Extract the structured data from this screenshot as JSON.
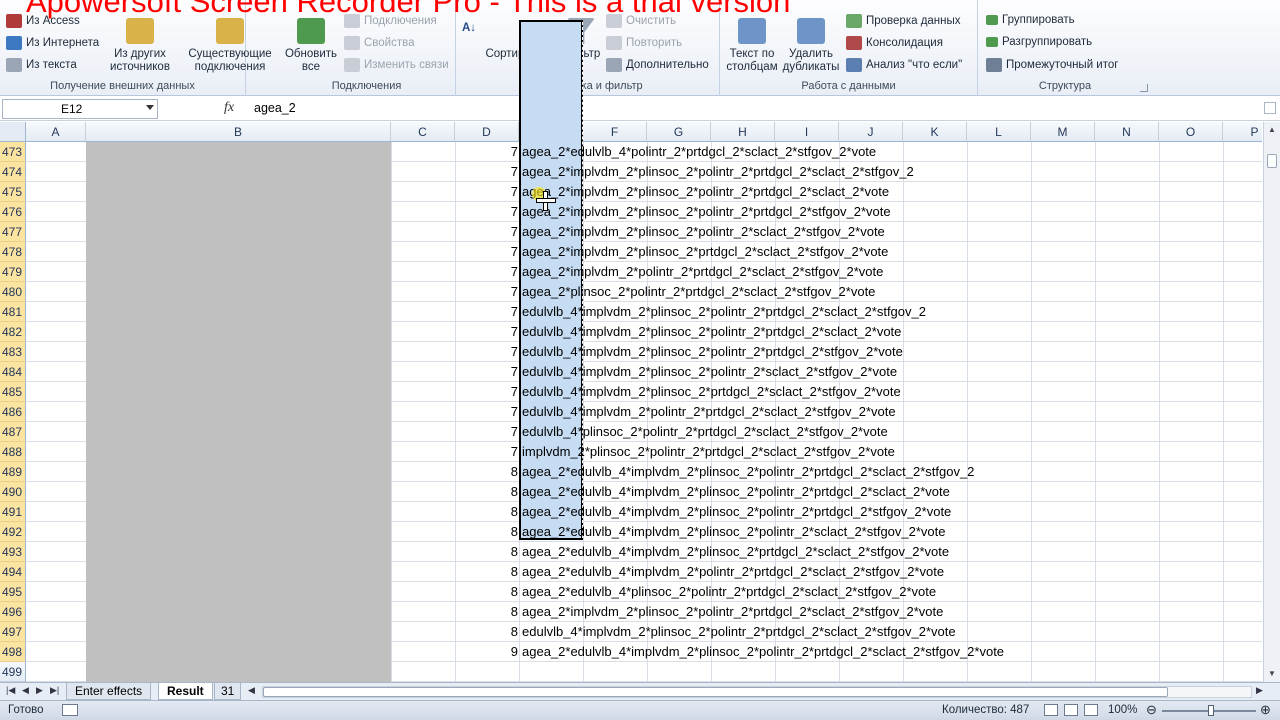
{
  "watermark": "Apowersoft Screen Recorder Pro - This is a trial version",
  "ribbon": {
    "groups": [
      {
        "label": "Получение внешних данных"
      },
      {
        "label": "Подключения"
      },
      {
        "label": "Сортировка и фильтр"
      },
      {
        "label": "Работа с данными"
      },
      {
        "label": "Структура"
      }
    ],
    "from_access": "Из Access",
    "from_web": "Из Интернета",
    "from_text": "Из текста",
    "from_other": "Из других источников",
    "existing": "Существующие подключения",
    "refresh_all": "Обновить все",
    "connections": "Подключения",
    "properties": "Свойства",
    "edit_links": "Изменить связи",
    "sort_az": "А↓",
    "sort": "Сортировка",
    "filter": "Фильтр",
    "clear": "Очистить",
    "reapply": "Повторить",
    "advanced": "Дополнительно",
    "text_to_columns": "Текст по столбцам",
    "remove_duplicates": "Удалить дубликаты",
    "data_validation": "Проверка данных",
    "consolidate": "Консолидация",
    "whatif": "Анализ \"что если\"",
    "group": "Группировать",
    "ungroup": "Разгруппировать",
    "subtotal": "Промежуточный итог"
  },
  "formula_bar": {
    "name_box": "E12",
    "fx": "fx",
    "value": "agea_2"
  },
  "columns": [
    "A",
    "B",
    "C",
    "D",
    "E",
    "F",
    "G",
    "H",
    "I",
    "J",
    "K",
    "L",
    "M",
    "N",
    "O",
    "P"
  ],
  "selected_column": "E",
  "rows": [
    {
      "n": "473",
      "d": "7",
      "text": "agea_2*edulvlb_4*polintr_2*prtdgcl_2*sclact_2*stfgov_2*vote"
    },
    {
      "n": "474",
      "d": "7",
      "text": "agea_2*implvdm_2*plinsoc_2*polintr_2*prtdgcl_2*sclact_2*stfgov_2"
    },
    {
      "n": "475",
      "d": "7",
      "text": "agea_2*implvdm_2*plinsoc_2*polintr_2*prtdgcl_2*sclact_2*vote"
    },
    {
      "n": "476",
      "d": "7",
      "text": "agea_2*implvdm_2*plinsoc_2*polintr_2*prtdgcl_2*stfgov_2*vote"
    },
    {
      "n": "477",
      "d": "7",
      "text": "agea_2*implvdm_2*plinsoc_2*polintr_2*sclact_2*stfgov_2*vote"
    },
    {
      "n": "478",
      "d": "7",
      "text": "agea_2*implvdm_2*plinsoc_2*prtdgcl_2*sclact_2*stfgov_2*vote"
    },
    {
      "n": "479",
      "d": "7",
      "text": "agea_2*implvdm_2*polintr_2*prtdgcl_2*sclact_2*stfgov_2*vote"
    },
    {
      "n": "480",
      "d": "7",
      "text": "agea_2*plinsoc_2*polintr_2*prtdgcl_2*sclact_2*stfgov_2*vote"
    },
    {
      "n": "481",
      "d": "7",
      "text": "edulvlb_4*implvdm_2*plinsoc_2*polintr_2*prtdgcl_2*sclact_2*stfgov_2"
    },
    {
      "n": "482",
      "d": "7",
      "text": "edulvlb_4*implvdm_2*plinsoc_2*polintr_2*prtdgcl_2*sclact_2*vote"
    },
    {
      "n": "483",
      "d": "7",
      "text": "edulvlb_4*implvdm_2*plinsoc_2*polintr_2*prtdgcl_2*stfgov_2*vote"
    },
    {
      "n": "484",
      "d": "7",
      "text": "edulvlb_4*implvdm_2*plinsoc_2*polintr_2*sclact_2*stfgov_2*vote"
    },
    {
      "n": "485",
      "d": "7",
      "text": "edulvlb_4*implvdm_2*plinsoc_2*prtdgcl_2*sclact_2*stfgov_2*vote"
    },
    {
      "n": "486",
      "d": "7",
      "text": "edulvlb_4*implvdm_2*polintr_2*prtdgcl_2*sclact_2*stfgov_2*vote"
    },
    {
      "n": "487",
      "d": "7",
      "text": "edulvlb_4*plinsoc_2*polintr_2*prtdgcl_2*sclact_2*stfgov_2*vote"
    },
    {
      "n": "488",
      "d": "7",
      "text": "implvdm_2*plinsoc_2*polintr_2*prtdgcl_2*sclact_2*stfgov_2*vote"
    },
    {
      "n": "489",
      "d": "8",
      "text": "agea_2*edulvlb_4*implvdm_2*plinsoc_2*polintr_2*prtdgcl_2*sclact_2*stfgov_2"
    },
    {
      "n": "490",
      "d": "8",
      "text": "agea_2*edulvlb_4*implvdm_2*plinsoc_2*polintr_2*prtdgcl_2*sclact_2*vote"
    },
    {
      "n": "491",
      "d": "8",
      "text": "agea_2*edulvlb_4*implvdm_2*plinsoc_2*polintr_2*prtdgcl_2*stfgov_2*vote"
    },
    {
      "n": "492",
      "d": "8",
      "text": "agea_2*edulvlb_4*implvdm_2*plinsoc_2*polintr_2*sclact_2*stfgov_2*vote"
    },
    {
      "n": "493",
      "d": "8",
      "text": "agea_2*edulvlb_4*implvdm_2*plinsoc_2*prtdgcl_2*sclact_2*stfgov_2*vote"
    },
    {
      "n": "494",
      "d": "8",
      "text": "agea_2*edulvlb_4*implvdm_2*polintr_2*prtdgcl_2*sclact_2*stfgov_2*vote"
    },
    {
      "n": "495",
      "d": "8",
      "text": "agea_2*edulvlb_4*plinsoc_2*polintr_2*prtdgcl_2*sclact_2*stfgov_2*vote"
    },
    {
      "n": "496",
      "d": "8",
      "text": "agea_2*implvdm_2*plinsoc_2*polintr_2*prtdgcl_2*sclact_2*stfgov_2*vote"
    },
    {
      "n": "497",
      "d": "8",
      "text": "edulvlb_4*implvdm_2*plinsoc_2*polintr_2*prtdgcl_2*sclact_2*stfgov_2*vote"
    },
    {
      "n": "498",
      "d": "9",
      "text": "agea_2*edulvlb_4*implvdm_2*plinsoc_2*polintr_2*prtdgcl_2*sclact_2*stfgov_2*vote"
    },
    {
      "n": "499",
      "d": "",
      "text": ""
    }
  ],
  "tabs": [
    {
      "label": "Enter effects",
      "active": false
    },
    {
      "label": "Result",
      "active": true
    },
    {
      "label": "31",
      "active": false
    }
  ],
  "status": {
    "ready": "Готово",
    "count": "Количество: 487",
    "zoom": "100%"
  }
}
